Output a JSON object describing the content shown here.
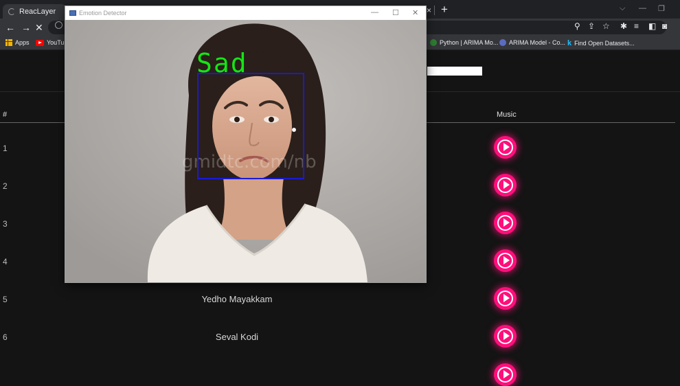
{
  "browser": {
    "tab_title": "ReacLayer",
    "new_tab_symbol": "+",
    "close_symbol": "×",
    "bookmarks": [
      {
        "label": "Apps"
      },
      {
        "label": "YouTub"
      },
      {
        "label": "Python | ARIMA Mo..."
      },
      {
        "label": "ARIMA Model - Co..."
      },
      {
        "label": "Find Open Datasets..."
      }
    ],
    "colors": {
      "accent": "#ff0f7b",
      "chrome_dark": "#202124",
      "chrome": "#35363a"
    }
  },
  "page": {
    "columns": {
      "number": "#",
      "music": "Music"
    },
    "rows": [
      {
        "num": "1",
        "song": ""
      },
      {
        "num": "2",
        "song": ""
      },
      {
        "num": "3",
        "song": ""
      },
      {
        "num": "4",
        "song": ""
      },
      {
        "num": "5",
        "song": "Yedho Mayakkam"
      },
      {
        "num": "6",
        "song": "Seval Kodi"
      }
    ]
  },
  "emotion_window": {
    "title": "Emotion Detector",
    "detected_emotion": "Sad",
    "watermark": "gmidtc.com/nb"
  }
}
